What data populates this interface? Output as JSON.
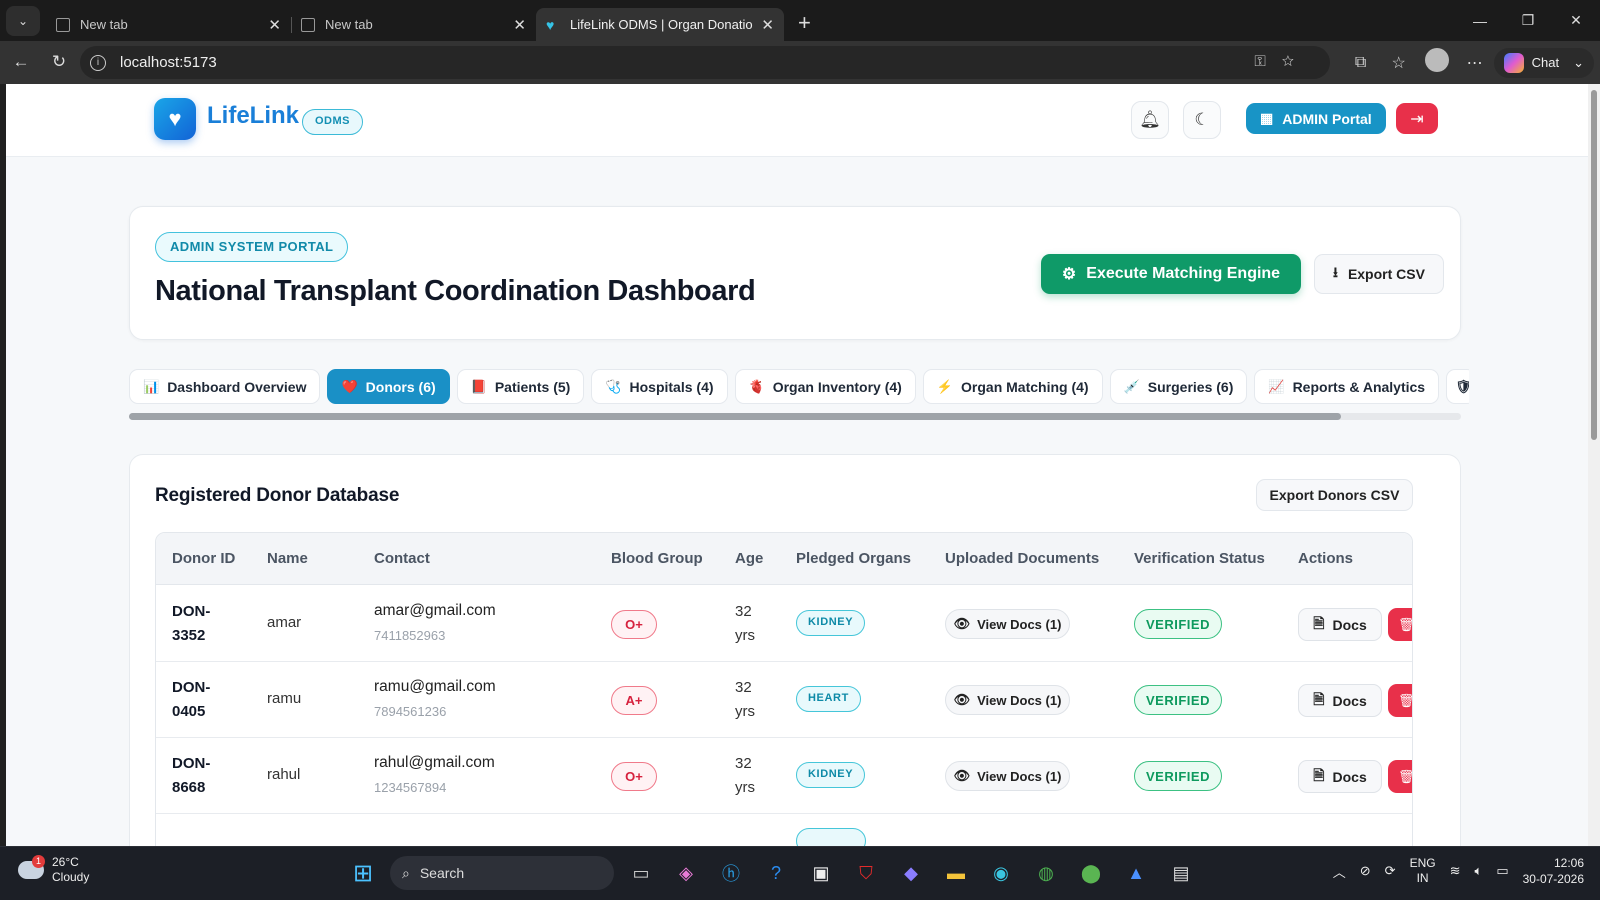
{
  "browser": {
    "tabs": [
      {
        "title": "New tab"
      },
      {
        "title": "New tab"
      },
      {
        "title": "LifeLink ODMS | Organ Donation M"
      }
    ],
    "url": "localhost:5173",
    "chat_label": "Chat"
  },
  "header": {
    "brand": "LifeLink",
    "brand_badge": "ODMS",
    "admin_portal_label": "ADMIN Portal"
  },
  "hero": {
    "badge": "ADMIN SYSTEM PORTAL",
    "title": "National Transplant Coordination Dashboard",
    "execute_label": "Execute Matching Engine",
    "export_label": "Export CSV"
  },
  "nav_tabs": [
    {
      "label": "Dashboard Overview",
      "icon": "📊"
    },
    {
      "label": "Donors (6)",
      "icon": "❤️"
    },
    {
      "label": "Patients (5)",
      "icon": "📕"
    },
    {
      "label": "Hospitals (4)",
      "icon": "🩺"
    },
    {
      "label": "Organ Inventory (4)",
      "icon": "🫀"
    },
    {
      "label": "Organ Matching (4)",
      "icon": "⚡"
    },
    {
      "label": "Surgeries (6)",
      "icon": "💉"
    },
    {
      "label": "Reports & Analytics",
      "icon": "📈"
    }
  ],
  "donors": {
    "title": "Registered Donor Database",
    "export_label": "Export Donors CSV",
    "columns": [
      "Donor ID",
      "Name",
      "Contact",
      "Blood Group",
      "Age",
      "Pledged Organs",
      "Uploaded Documents",
      "Verification Status",
      "Actions"
    ],
    "rows": [
      {
        "id": "DON-3352",
        "name": "amar",
        "email": "amar@gmail.com",
        "phone": "7411852963",
        "blood": "O+",
        "age": "32 yrs",
        "organ": "KIDNEY",
        "docs": "View Docs (1)",
        "status": "VERIFIED",
        "action": "Docs"
      },
      {
        "id": "DON-0405",
        "name": "ramu",
        "email": "ramu@gmail.com",
        "phone": "7894561236",
        "blood": "A+",
        "age": "32 yrs",
        "organ": "HEART",
        "docs": "View Docs (1)",
        "status": "VERIFIED",
        "action": "Docs"
      },
      {
        "id": "DON-8668",
        "name": "rahul",
        "email": "rahul@gmail.com",
        "phone": "1234567894",
        "blood": "O+",
        "age": "32 yrs",
        "organ": "KIDNEY",
        "docs": "View Docs (1)",
        "status": "VERIFIED",
        "action": "Docs"
      }
    ]
  },
  "taskbar": {
    "temp": "26°C",
    "weather": "Cloudy",
    "weather_badge": "1",
    "search_label": "Search",
    "lang_top": "ENG",
    "lang_bottom": "IN",
    "time": "12:06",
    "date": "30-07-2026"
  }
}
